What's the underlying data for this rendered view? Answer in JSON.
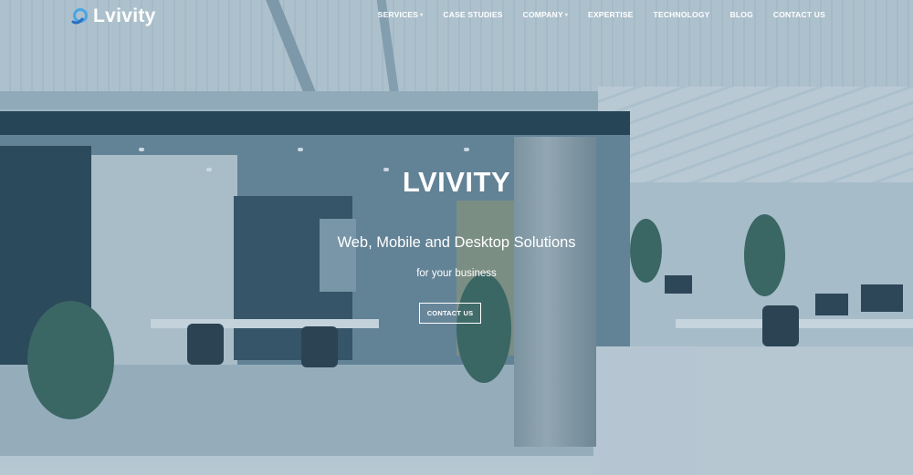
{
  "brand": {
    "name": "Lvivity",
    "logo_icon": "lvivity-logo-icon",
    "logo_colors": [
      "#2f7fd0",
      "#7fd0f0"
    ]
  },
  "nav": {
    "items": [
      {
        "label": "SERVICES",
        "has_dropdown": true
      },
      {
        "label": "CASE STUDIES",
        "has_dropdown": false
      },
      {
        "label": "COMPANY",
        "has_dropdown": true
      },
      {
        "label": "EXPERTISE",
        "has_dropdown": false
      },
      {
        "label": "TECHNOLOGY",
        "has_dropdown": false
      },
      {
        "label": "BLOG",
        "has_dropdown": false
      },
      {
        "label": "CONTACT US",
        "has_dropdown": false
      }
    ],
    "dropdown_icon": "chevron-down-icon"
  },
  "hero": {
    "title": "LVIVITY",
    "subtitle": "Web, Mobile and Desktop Solutions",
    "tagline": "for your business",
    "cta_label": "CONTACT US"
  },
  "colors": {
    "overlay": "#285a7d",
    "text": "#ffffff"
  }
}
